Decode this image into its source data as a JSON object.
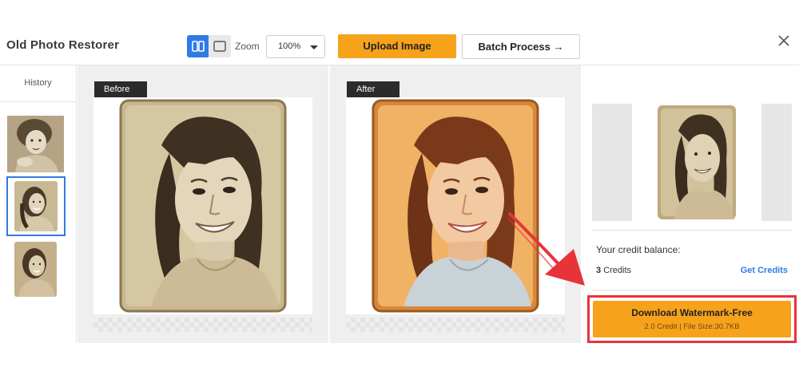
{
  "header": {
    "app_title": "Old Photo Restorer",
    "zoom_label": "Zoom",
    "zoom_value": "100%",
    "upload_label": "Upload Image",
    "batch_label": "Batch Process →"
  },
  "history": {
    "title": "History",
    "items": [
      {
        "name": "child-portrait",
        "selected": false
      },
      {
        "name": "woman-portrait",
        "selected": true
      },
      {
        "name": "woman-portrait-2",
        "selected": false
      }
    ]
  },
  "panels": {
    "before_label": "Before",
    "after_label": "After"
  },
  "sidebar": {
    "credit_balance_label": "Your credit balance:",
    "credits_count": "3",
    "credits_unit": "Credits",
    "get_credits_label": "Get Credits",
    "download_title": "Download Watermark-Free",
    "download_sub": "2.0 Credit | File Size:30.7KB"
  },
  "colors": {
    "accent_orange": "#f7a21b",
    "accent_blue": "#2f7be5",
    "highlight_red": "#e8333a"
  }
}
